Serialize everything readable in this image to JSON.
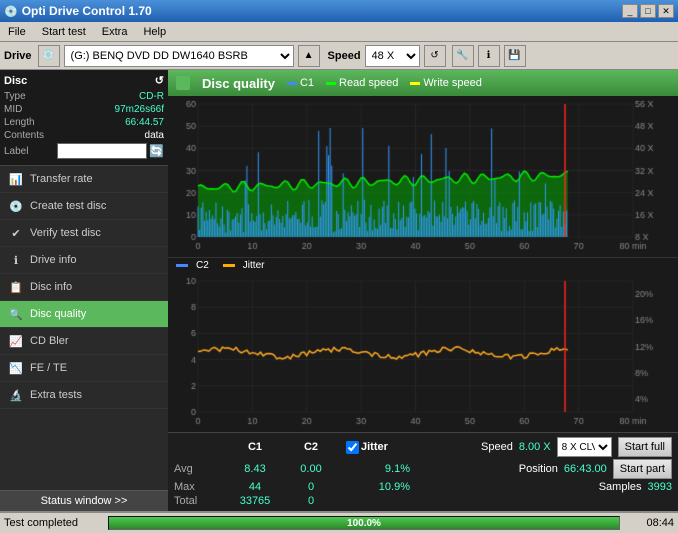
{
  "app": {
    "title": "Opti Drive Control 1.70",
    "icon": "disc"
  },
  "titlebar": {
    "minimize": "_",
    "maximize": "□",
    "close": "✕"
  },
  "menu": {
    "items": [
      "File",
      "Start test",
      "Extra",
      "Help"
    ]
  },
  "drivebar": {
    "label": "Drive",
    "drive_value": "(G:)  BENQ DVD DD DW1640 BSRB",
    "speed_label": "Speed",
    "speed_value": "48 X"
  },
  "disc": {
    "type_label": "Type",
    "type_val": "CD-R",
    "mid_label": "MID",
    "mid_val": "97m26s66f",
    "length_label": "Length",
    "length_val": "66:44.57",
    "contents_label": "Contents",
    "contents_val": "data",
    "label_label": "Label",
    "label_val": ""
  },
  "sidebar": {
    "items": [
      {
        "id": "transfer-rate",
        "label": "Transfer rate",
        "icon": "📊"
      },
      {
        "id": "create-test-disc",
        "label": "Create test disc",
        "icon": "💿"
      },
      {
        "id": "verify-test-disc",
        "label": "Verify test disc",
        "icon": "✔"
      },
      {
        "id": "drive-info",
        "label": "Drive info",
        "icon": "ℹ"
      },
      {
        "id": "disc-info",
        "label": "Disc info",
        "icon": "📋"
      },
      {
        "id": "disc-quality",
        "label": "Disc quality",
        "icon": "🔍",
        "active": true
      },
      {
        "id": "cd-bler",
        "label": "CD Bler",
        "icon": "📈"
      },
      {
        "id": "fe-te",
        "label": "FE / TE",
        "icon": "📉"
      },
      {
        "id": "extra-tests",
        "label": "Extra tests",
        "icon": "🔬"
      }
    ],
    "status_window": "Status window >>"
  },
  "disc_quality": {
    "title": "Disc quality",
    "legend": {
      "c1": "C1",
      "read_speed": "Read speed",
      "write_speed": "Write speed",
      "c2": "C2",
      "jitter": "Jitter"
    },
    "chart1": {
      "y_max": 60,
      "y_right_labels": [
        "56 X",
        "48 X",
        "40 X",
        "32 X",
        "24 X",
        "16 X",
        "8 X"
      ],
      "x_labels": [
        "0",
        "10",
        "20",
        "30",
        "40",
        "50",
        "60",
        "70",
        "80 min"
      ]
    },
    "chart2": {
      "y_max": 10,
      "y_right_labels": [
        "20%",
        "16%",
        "12%",
        "8%",
        "4%"
      ],
      "x_labels": [
        "0",
        "10",
        "20",
        "30",
        "40",
        "50",
        "60",
        "70",
        "80 min"
      ]
    },
    "stats": {
      "col_c1": "C1",
      "col_c2": "C2",
      "jitter_checked": true,
      "col_jitter": "Jitter",
      "speed_label": "Speed",
      "speed_val": "8.00 X",
      "position_label": "Position",
      "position_val": "66:43.00",
      "samples_label": "Samples",
      "samples_val": "3993",
      "clv_option": "8 X CLV",
      "avg_label": "Avg",
      "avg_c1": "8.43",
      "avg_c2": "0.00",
      "avg_jitter": "9.1%",
      "max_label": "Max",
      "max_c1": "44",
      "max_c2": "0",
      "max_jitter": "10.9%",
      "total_label": "Total",
      "total_c1": "33765",
      "total_c2": "0",
      "start_full": "Start full",
      "start_part": "Start part"
    }
  },
  "statusbar": {
    "text": "Test completed",
    "progress": 100,
    "progress_text": "100.0%",
    "time": "08:44"
  },
  "colors": {
    "green": "#5cb85c",
    "cyan": "#00ffcc",
    "red": "#ff3333",
    "yellow": "#ffff00",
    "blue": "#4488ff",
    "chart_bg": "#1a1a1a",
    "grid": "#2a2a2a"
  }
}
